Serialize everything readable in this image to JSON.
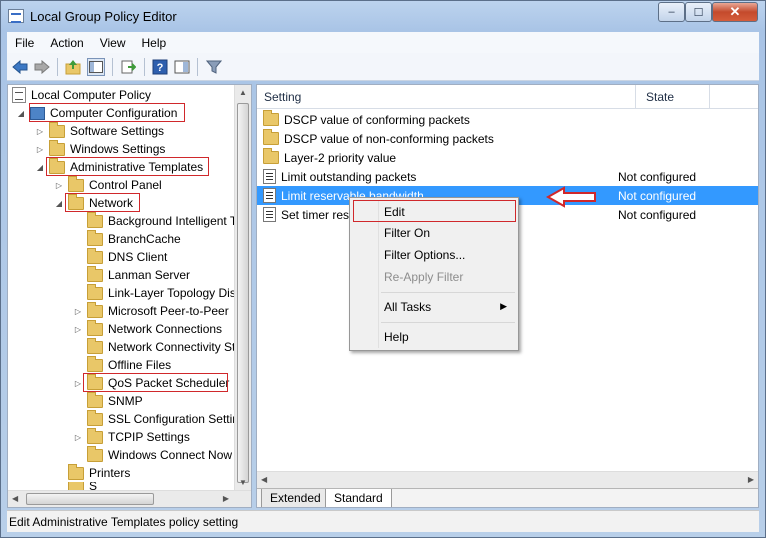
{
  "window": {
    "title": "Local Group Policy Editor",
    "minimize": "–",
    "maximize": "☐",
    "close": "✕"
  },
  "menu": [
    "File",
    "Action",
    "View",
    "Help"
  ],
  "tree": {
    "root": "Local Computer Policy",
    "computer_config": "Computer Configuration",
    "software_settings": "Software Settings",
    "windows_settings": "Windows Settings",
    "admin_templates": "Administrative Templates",
    "control_panel": "Control Panel",
    "network": "Network",
    "network_children": [
      "Background Intelligent T",
      "BranchCache",
      "DNS Client",
      "Lanman Server",
      "Link-Layer Topology Dis",
      "Microsoft Peer-to-Peer",
      "Network Connections",
      "Network Connectivity St",
      "Offline Files",
      "QoS Packet Scheduler",
      "SNMP",
      "SSL Configuration Settin",
      "TCPIP Settings",
      "Windows Connect Now"
    ],
    "printers": "Printers",
    "cut_item": "S"
  },
  "list": {
    "col_setting": "Setting",
    "col_state": "State",
    "rows": [
      {
        "name": "DSCP value of conforming packets",
        "state": ""
      },
      {
        "name": "DSCP value of non-conforming packets",
        "state": ""
      },
      {
        "name": "Layer-2 priority value",
        "state": ""
      },
      {
        "name": "Limit outstanding packets",
        "state": "Not configured"
      },
      {
        "name": "Limit reservable bandwidth",
        "state": "Not configured"
      },
      {
        "name": "Set timer reso",
        "state": "Not configured"
      }
    ]
  },
  "context_menu": {
    "edit": "Edit",
    "filter_on": "Filter On",
    "filter_options": "Filter Options...",
    "reapply_filter": "Re-Apply Filter",
    "all_tasks": "All Tasks",
    "all_tasks_arrow": "▶",
    "help": "Help"
  },
  "tabs": {
    "extended": "Extended",
    "standard": "Standard"
  },
  "status": "Edit Administrative Templates policy setting",
  "colors": {
    "selection": "#3399ff",
    "highlight_box": "#d0282b",
    "folder": "#e9c768"
  }
}
